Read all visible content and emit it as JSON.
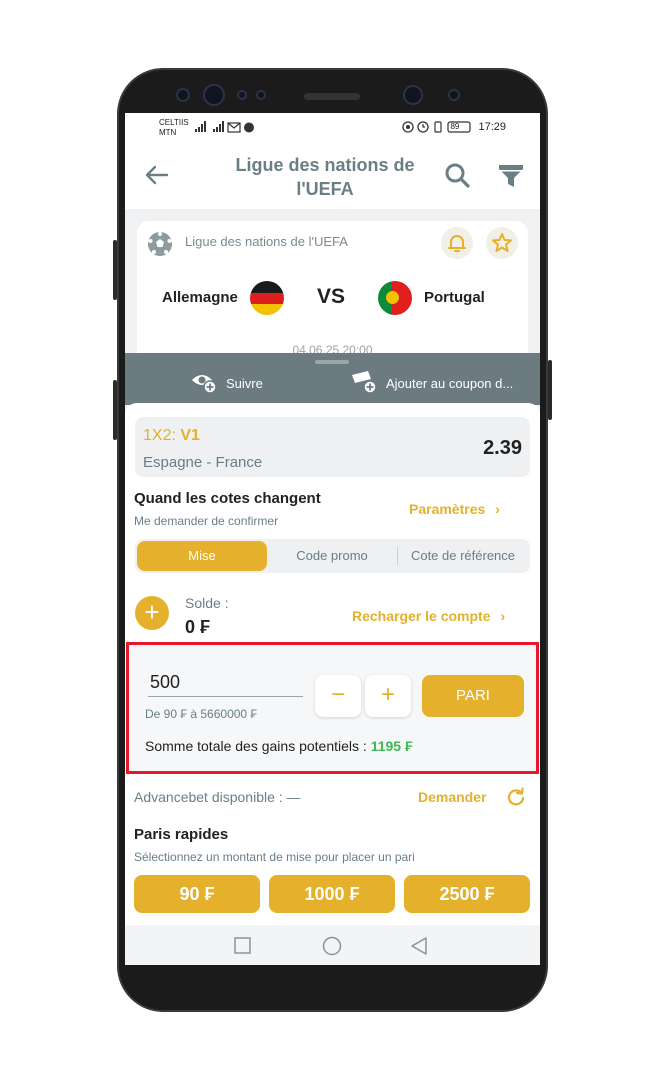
{
  "status_bar": {
    "carrier_top": "CELTIIS",
    "carrier_bottom": "MTN",
    "battery": "89",
    "time": "17:29"
  },
  "header": {
    "title_line1": "Ligue des nations de",
    "title_line2": "l'UEFA"
  },
  "match": {
    "league": "Ligue des nations de l'UEFA",
    "home_team": "Allemagne",
    "away_team": "Portugal",
    "vs": "VS",
    "date": "04.06.25 20:00"
  },
  "sheet": {
    "follow_label": "Suivre",
    "add_coupon_label": "Ajouter au coupon d..."
  },
  "bet": {
    "type_prefix": "1X2:",
    "type_pick": "V1",
    "match": "Espagne - France",
    "odd": "2.39"
  },
  "odds_change": {
    "title": "Quand les cotes changent",
    "subtitle": "Me demander de confirmer",
    "link": "Paramètres"
  },
  "tabs": [
    "Mise",
    "Code promo",
    "Cote de référence"
  ],
  "balance": {
    "label": "Solde :",
    "value": "0 ₣",
    "recharge": "Recharger le compte"
  },
  "stake": {
    "value": "500",
    "range": "De 90 ₣ à 5660000 ₣",
    "minus": "−",
    "plus": "+",
    "submit": "PARI",
    "gains_label": "Somme totale des gains potentiels :",
    "gains_value": "1195 ₣"
  },
  "advancebet": {
    "label": "Advancebet disponible : —",
    "link": "Demander"
  },
  "quick_bets": {
    "title": "Paris rapides",
    "subtitle": "Sélectionnez un montant de mise pour placer un pari",
    "amounts": [
      "90 ₣",
      "1000 ₣",
      "2500 ₣"
    ]
  },
  "colors": {
    "accent": "#e5b12c",
    "header_text": "#6a7e86",
    "sheet_header": "#6b7b80",
    "highlight_border": "#e8172b",
    "gain_green": "#3fb950"
  }
}
